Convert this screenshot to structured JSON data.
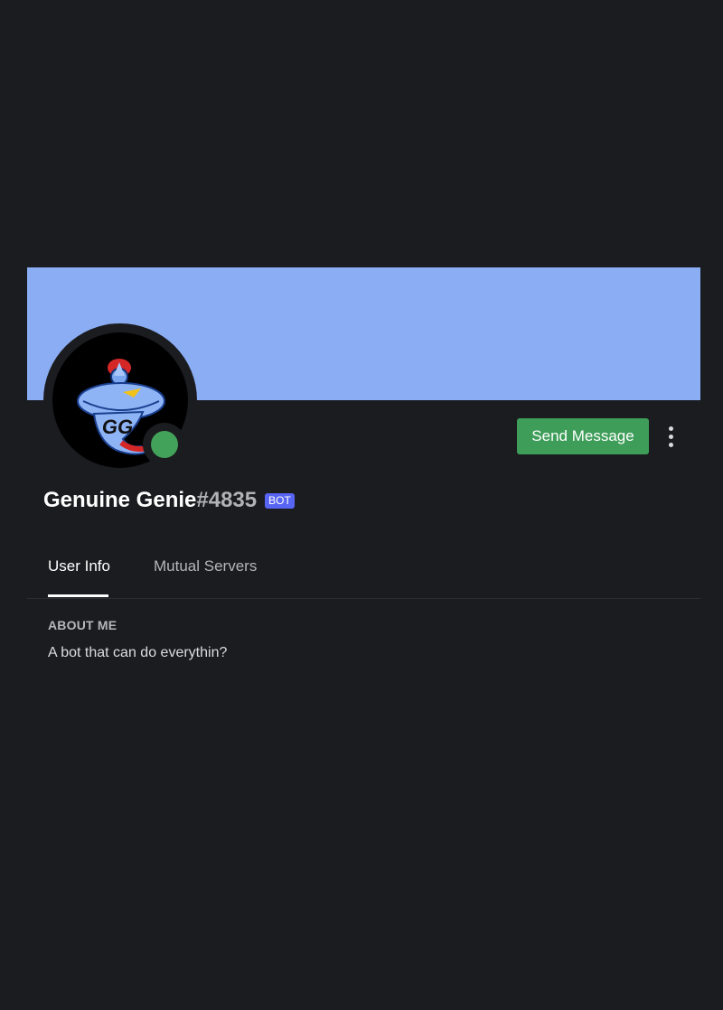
{
  "colors": {
    "background": "#1b1c20",
    "banner": "#8aadf4",
    "send_button": "#3e9e59",
    "status_online": "#43a25a",
    "bot_badge": "#5865f2"
  },
  "profile": {
    "username": "Genuine Genie",
    "discriminator": "#4835",
    "badge": "BOT",
    "avatar_icon": "genie-avatar-icon",
    "avatar_text": "GG",
    "status": "online"
  },
  "actions": {
    "send_message_label": "Send Message",
    "more_icon": "more-vertical-icon"
  },
  "tabs": [
    {
      "label": "User Info",
      "active": true
    },
    {
      "label": "Mutual Servers",
      "active": false
    }
  ],
  "about": {
    "heading": "ABOUT ME",
    "text": "A bot that can do everythin?"
  }
}
